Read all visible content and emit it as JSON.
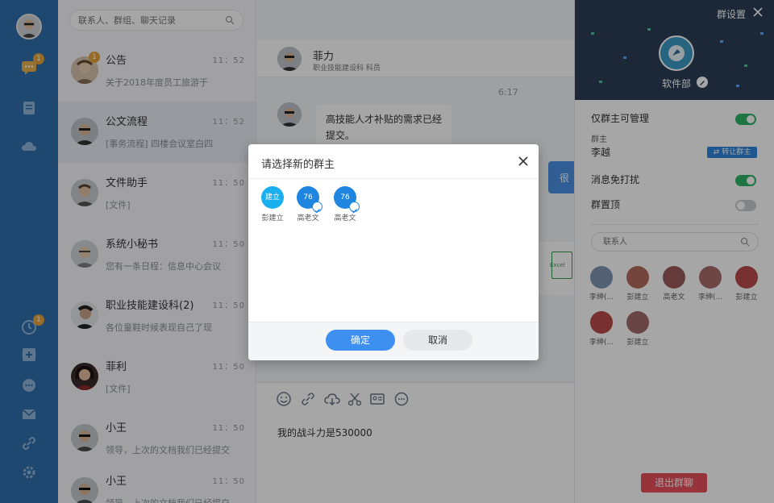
{
  "conv_list": {
    "search_placeholder": "联系人、群组、聊天记录",
    "items": [
      {
        "name": "公告",
        "time": "11：52",
        "preview": "关于2018年度员工旅游于",
        "badge": "1"
      },
      {
        "name": "公文流程",
        "time": "11：52",
        "preview": "[事务流程] 四楼会议室白四"
      },
      {
        "name": "文件助手",
        "time": "11：50",
        "preview": "[文件]"
      },
      {
        "name": "系统小秘书",
        "time": "11：50",
        "preview": "您有一条日程：信息中心会议"
      },
      {
        "name": "职业技能建设科(2)",
        "time": "11：50",
        "preview": "各位童鞋时候表现自己了现"
      },
      {
        "name": "菲利",
        "time": "11：50",
        "preview": "[文件]"
      },
      {
        "name": "小王",
        "time": "11：50",
        "preview": "领导，上次的文档我们已经提交"
      },
      {
        "name": "小王",
        "time": "11：50",
        "preview": "领导，上次的文档我们已经提交"
      }
    ]
  },
  "rail": {
    "chat_badge": "1",
    "bottom_badge": "1"
  },
  "chat": {
    "header_name": "菲力",
    "header_dept": "职业技能建设科 科员",
    "msg_time": "6:17",
    "bubble_text": "高技能人才补贴的需求已经提交。",
    "blue_bubble_text": "很",
    "file_label": "Excel",
    "composer_text": "我的战斗力是530000"
  },
  "panel": {
    "title": "群设置",
    "group_name": "软件部",
    "only_owner_manage": "仅群主可管理",
    "owner_label": "群主",
    "owner_name": "李越",
    "transfer_label": "⇄ 转让群主",
    "mute": "消息免打扰",
    "pin": "群置顶",
    "contact_placeholder": "联系人",
    "members": [
      "李绅(...",
      "彭建立",
      "高老文",
      "李绅(...",
      "彭建立",
      "李绅(...",
      "彭建立"
    ],
    "leave_label": "退出群聊"
  },
  "modal": {
    "title": "请选择新的群主",
    "candidates": [
      {
        "avatar_text": "建立",
        "name": "彭建立"
      },
      {
        "avatar_text": "76",
        "name": "高老文"
      },
      {
        "avatar_text": "76",
        "name": "高老文"
      }
    ],
    "ok_label": "确定",
    "cancel_label": "取消"
  },
  "colors": {
    "rail": "#2f6fad",
    "accent": "#3d8ff0",
    "toggle_on": "#2fb465",
    "danger": "#e8505b",
    "badge": "#e8a33d"
  }
}
